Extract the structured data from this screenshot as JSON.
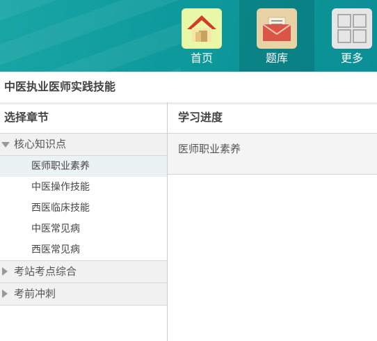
{
  "nav": {
    "items": [
      {
        "label": "首页",
        "icon": "home-icon"
      },
      {
        "label": "题库",
        "icon": "envelope-icon"
      },
      {
        "label": "更多",
        "icon": "grid-icon"
      }
    ],
    "active_index": 1
  },
  "page_title": "中医执业医师实践技能",
  "chapters": {
    "header": "选择章节",
    "groups": [
      {
        "label": "核心知识点",
        "expanded": true,
        "items": [
          "医师职业素养",
          "中医操作技能",
          "西医临床技能",
          "中医常见病",
          "西医常见病"
        ],
        "selected": "医师职业素养"
      },
      {
        "label": "考站考点综合",
        "expanded": false
      },
      {
        "label": "考前冲刺",
        "expanded": false
      }
    ]
  },
  "progress": {
    "header": "学习进度",
    "current": "医师职业素养"
  },
  "colors": {
    "header_teal": "#0e9a9c"
  }
}
